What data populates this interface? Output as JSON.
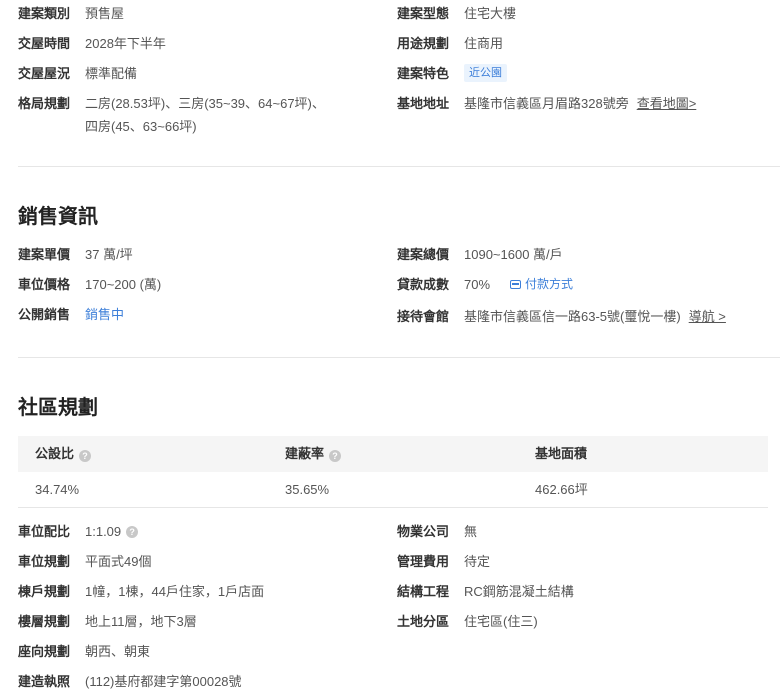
{
  "basic": {
    "type": {
      "label": "建案類別",
      "value": "預售屋"
    },
    "form": {
      "label": "建案型態",
      "value": "住宅大樓"
    },
    "delivery": {
      "label": "交屋時間",
      "value": "2028年下半年"
    },
    "usage": {
      "label": "用途規劃",
      "value": "住商用"
    },
    "condition": {
      "label": "交屋屋況",
      "value": "標準配備"
    },
    "feature": {
      "label": "建案特色",
      "tag": "近公園"
    },
    "layout": {
      "label": "格局規劃",
      "line1": "二房(28.53坪)、三房(35~39、64~67坪)、",
      "line2": "四房(45、63~66坪)"
    },
    "address": {
      "label": "基地地址",
      "value": "基隆市信義區月眉路328號旁",
      "link": "查看地圖>"
    }
  },
  "sales": {
    "title": "銷售資訊",
    "unit_price": {
      "label": "建案單價",
      "value": "37 萬/坪"
    },
    "total_price": {
      "label": "建案總價",
      "value": "1090~1600 萬/戶"
    },
    "parking_price": {
      "label": "車位價格",
      "value": "170~200 (萬)"
    },
    "loan": {
      "label": "貸款成數",
      "value": "70%",
      "link": "付款方式"
    },
    "public_sale": {
      "label": "公開銷售",
      "value": "銷售中"
    },
    "reception": {
      "label": "接待會館",
      "value": "基隆市信義區信一路63-5號(璽悅一樓)",
      "link": "導航 >"
    }
  },
  "community": {
    "title": "社區規劃",
    "table": {
      "headers": [
        "公設比",
        "建蔽率",
        "基地面積"
      ],
      "values": [
        "34.74%",
        "35.65%",
        "462.66坪"
      ]
    },
    "parking_ratio": {
      "label": "車位配比",
      "value": "1:1.09"
    },
    "property_mgmt": {
      "label": "物業公司",
      "value": "無"
    },
    "parking_plan": {
      "label": "車位規劃",
      "value": "平面式49個"
    },
    "mgmt_fee": {
      "label": "管理費用",
      "value": "待定"
    },
    "units_plan": {
      "label": "棟戶規劃",
      "value": "1幢，1棟，44戶住家，1戶店面"
    },
    "structure": {
      "label": "結構工程",
      "value": "RC鋼筋混凝土結構"
    },
    "floors": {
      "label": "樓層規劃",
      "value": "地上11層，地下3層"
    },
    "zoning": {
      "label": "土地分區",
      "value": "住宅區(住三)"
    },
    "orientation": {
      "label": "座向規劃",
      "value": "朝西、朝東"
    },
    "permit": {
      "label": "建造執照",
      "value": "(112)基府都建字第00028號"
    }
  },
  "colors": {
    "accent": "#3d7fd9",
    "tag_bg": "#eaf3fd",
    "divider": "#e6e6e6",
    "table_head": "#f5f5f5"
  }
}
